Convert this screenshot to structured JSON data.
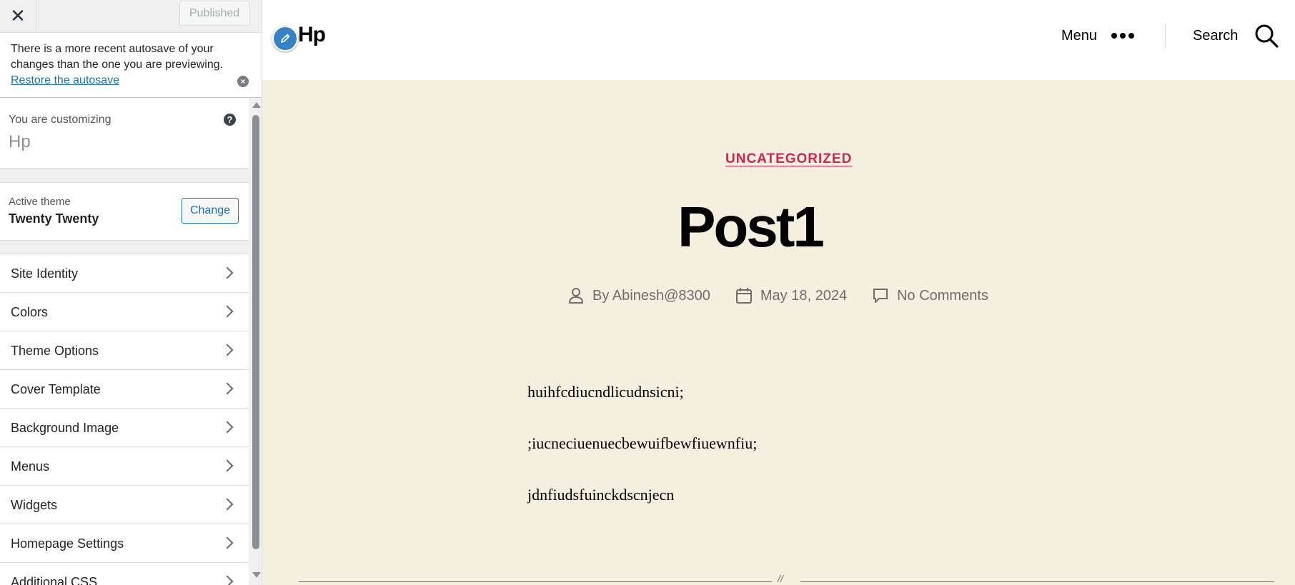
{
  "customizer": {
    "close_glyph": "✕",
    "publish_label": "Published",
    "notice": {
      "text": "There is a more recent autosave of your changes than the one you are previewing.",
      "link": "Restore the autosave"
    },
    "customizing_label": "You are customizing",
    "site_name": "Hp",
    "help_glyph": "?",
    "active_theme_label": "Active theme",
    "active_theme_name": "Twenty Twenty",
    "change_label": "Change",
    "sections": [
      {
        "label": "Site Identity"
      },
      {
        "label": "Colors"
      },
      {
        "label": "Theme Options"
      },
      {
        "label": "Cover Template"
      },
      {
        "label": "Background Image"
      },
      {
        "label": "Menus"
      },
      {
        "label": "Widgets"
      },
      {
        "label": "Homepage Settings"
      },
      {
        "label": "Additional CSS"
      }
    ]
  },
  "preview": {
    "site_title": "Hp",
    "menu_label": "Menu",
    "search_label": "Search",
    "category": "UNCATEGORIZED",
    "post_title": "Post1",
    "meta": {
      "author": "By Abinesh@8300",
      "date": "May 18, 2024",
      "comments": "No Comments"
    },
    "content": [
      "huihfcdiucndlicudnsicni;",
      ";iucneciuenuecbewuifbewfiuewnfiu;",
      "jdnfiudsfuinckdscnjecn"
    ],
    "separator_mark": "//"
  },
  "colors": {
    "accent": "#cd2653",
    "link": "#2271b1",
    "preview_background": "#f5efe0"
  }
}
